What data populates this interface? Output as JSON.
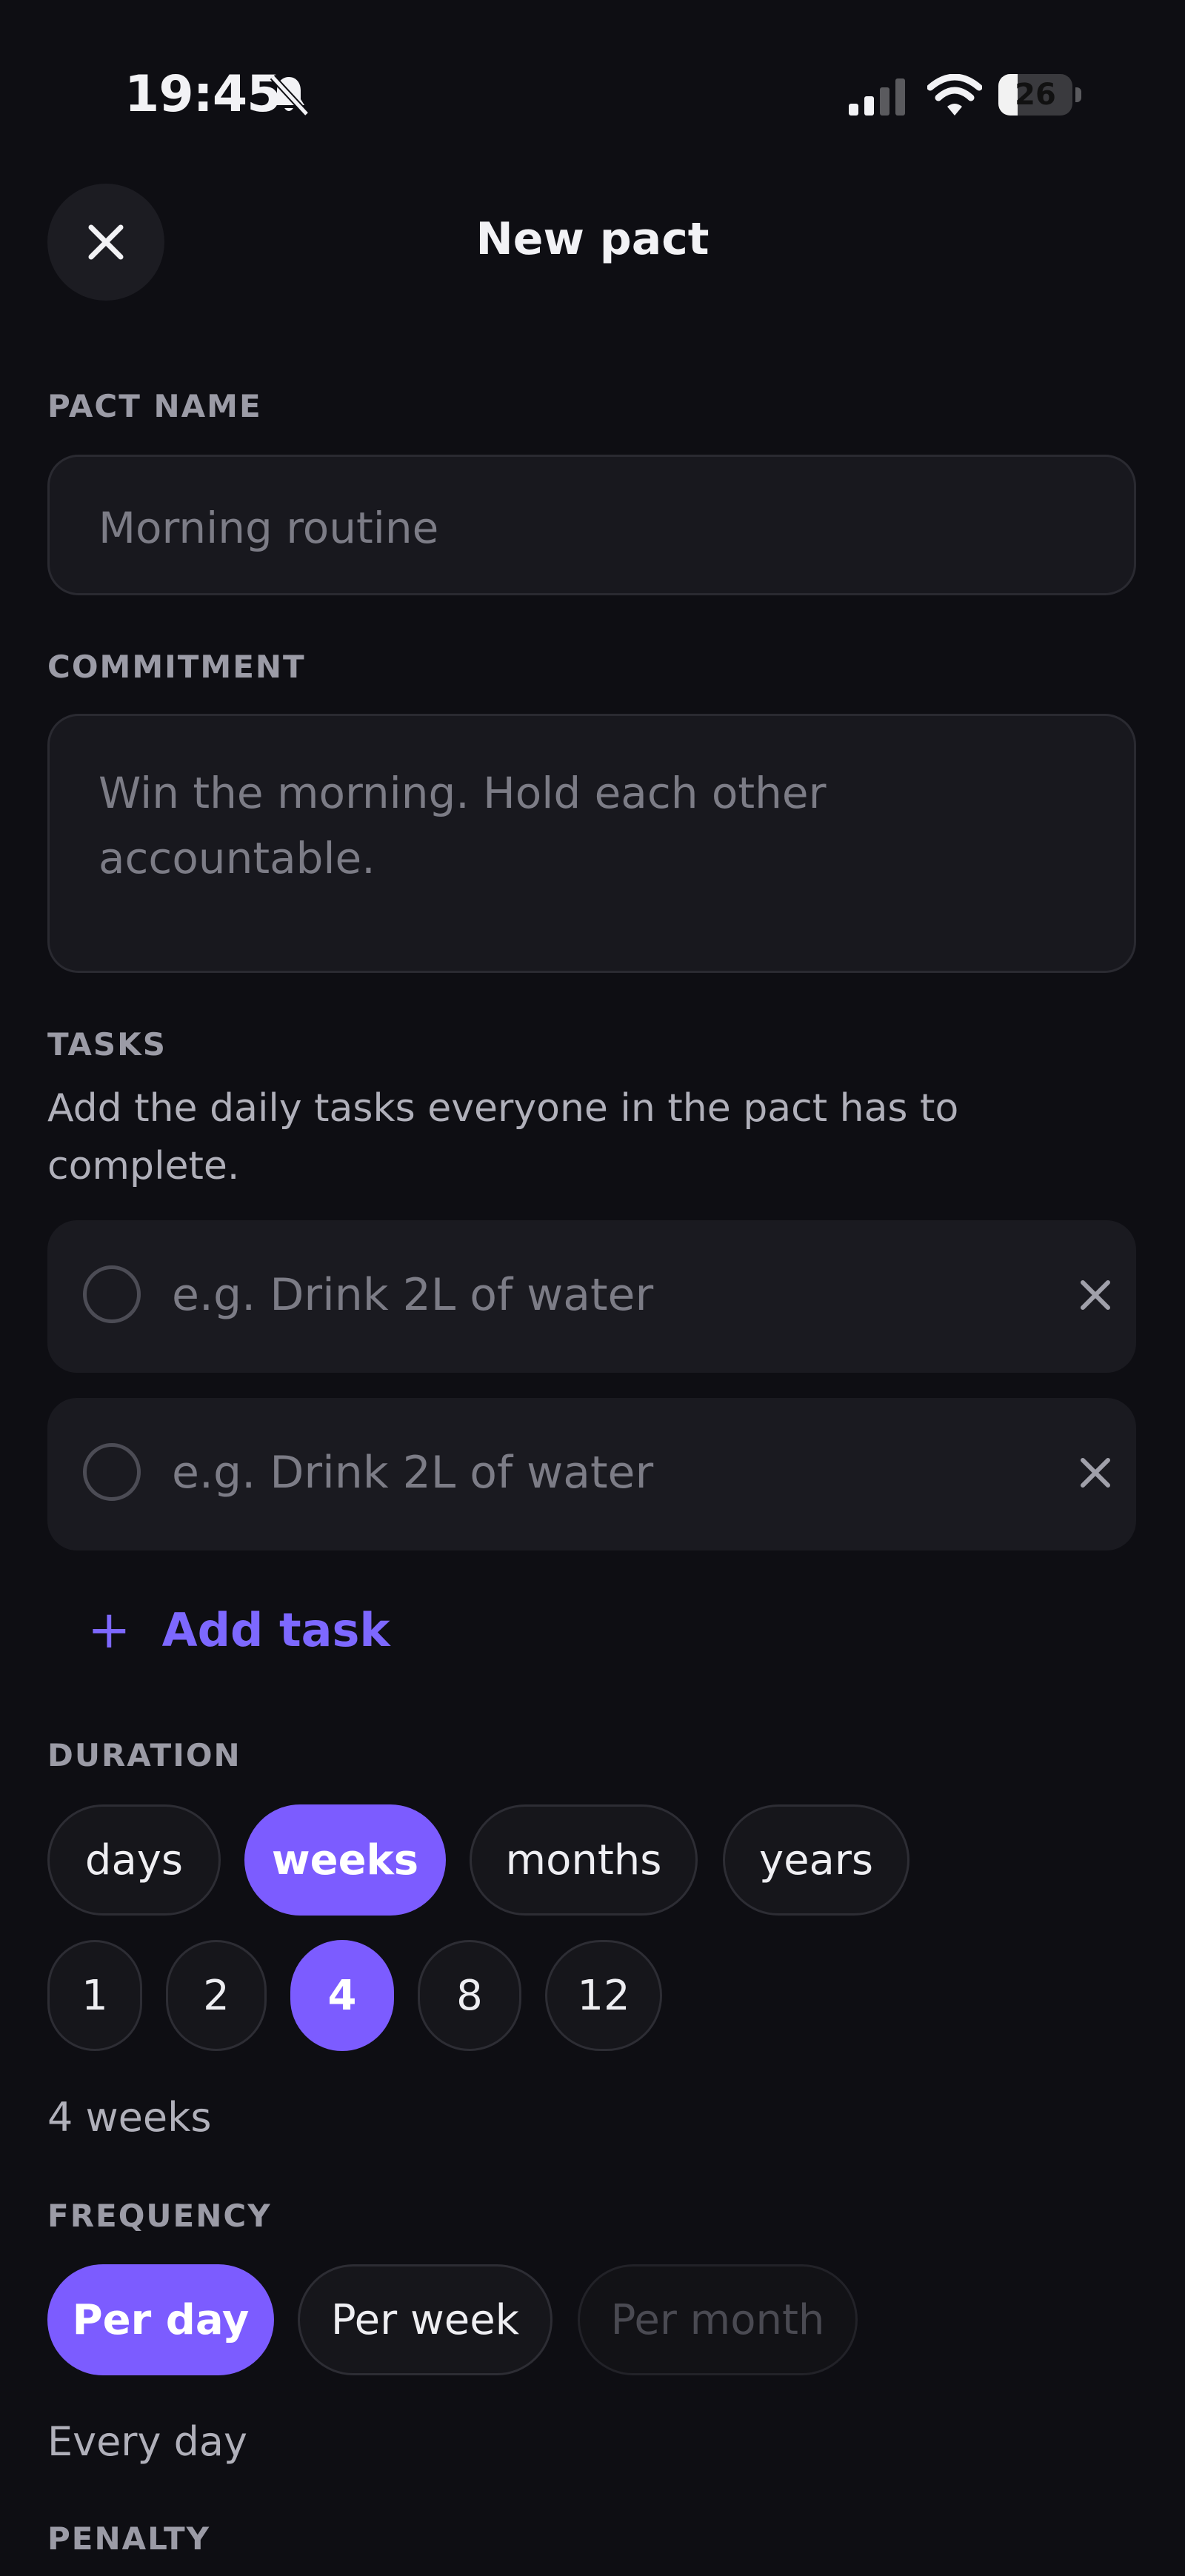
{
  "status_bar": {
    "time": "19:45",
    "battery": "26",
    "battery_level": 0.26
  },
  "header": {
    "title": "New pact"
  },
  "pact_name": {
    "label": "PACT NAME",
    "placeholder": "Morning routine"
  },
  "commitment": {
    "label": "COMMITMENT",
    "placeholder_line1": "Win the morning. Hold each other",
    "placeholder_line2": "accountable."
  },
  "tasks": {
    "label": "TASKS",
    "helper_line1": "Add the daily tasks everyone in the pact has to",
    "helper_line2": "complete.",
    "items": [
      {
        "placeholder": "e.g. Drink 2L of water"
      },
      {
        "placeholder": "e.g. Drink 2L of water"
      }
    ],
    "add_label": "Add task"
  },
  "duration": {
    "label": "DURATION",
    "units": [
      "days",
      "weeks",
      "months",
      "years"
    ],
    "selected_unit": "weeks",
    "counts": [
      "1",
      "2",
      "4",
      "8",
      "12"
    ],
    "selected_count": "4",
    "summary": "4 weeks"
  },
  "frequency": {
    "label": "FREQUENCY",
    "options": [
      "Per day",
      "Per week",
      "Per month"
    ],
    "selected": "Per day",
    "disabled": "Per month",
    "summary": "Every day"
  },
  "penalty": {
    "label": "PENALTY"
  },
  "colors": {
    "accent": "#7c5cff",
    "background": "#0e0e13",
    "field": "#18181e"
  }
}
